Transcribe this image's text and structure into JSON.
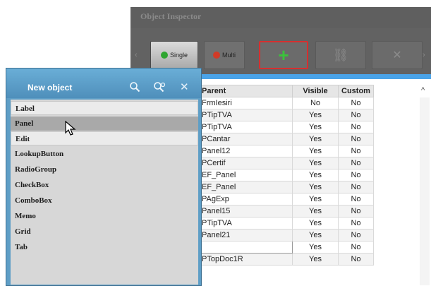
{
  "window": {
    "title": "Object Inspector"
  },
  "toolbar": {
    "single_label": "Single",
    "multi_label": "Multi",
    "add_symbol": "+",
    "link_symbol": "⛓",
    "delete_symbol": "✕",
    "colors": {
      "single_dot": "#2fa531",
      "multi_dot": "#d13a27",
      "add": "#3cc23c",
      "highlight_border": "#d62f2f"
    }
  },
  "new_object": {
    "title": "New object",
    "items": [
      {
        "label": "Label",
        "state": "light"
      },
      {
        "label": "Panel",
        "state": "selected"
      },
      {
        "label": "Edit",
        "state": "light"
      },
      {
        "label": "LookupButton",
        "state": "plain"
      },
      {
        "label": "RadioGroup",
        "state": "plain"
      },
      {
        "label": "CheckBox",
        "state": "plain"
      },
      {
        "label": "ComboBox",
        "state": "plain"
      },
      {
        "label": "Memo",
        "state": "plain"
      },
      {
        "label": "Grid",
        "state": "plain"
      },
      {
        "label": "Tab",
        "state": "plain"
      }
    ]
  },
  "grid": {
    "columns": [
      "Parent",
      "Visible",
      "Custom"
    ],
    "rows": [
      [
        "FrmIesiri",
        "No",
        "No"
      ],
      [
        "PTipTVA",
        "Yes",
        "No"
      ],
      [
        "PTipTVA",
        "Yes",
        "No"
      ],
      [
        "PCantar",
        "Yes",
        "No"
      ],
      [
        "Panel12",
        "Yes",
        "No"
      ],
      [
        "PCertif",
        "Yes",
        "No"
      ],
      [
        "EF_Panel",
        "Yes",
        "No"
      ],
      [
        "EF_Panel",
        "Yes",
        "No"
      ],
      [
        "PAgExp",
        "Yes",
        "No"
      ],
      [
        "Panel15",
        "Yes",
        "No"
      ],
      [
        "PTipTVA",
        "Yes",
        "No"
      ],
      [
        "Panel21",
        "Yes",
        "No"
      ],
      [
        "",
        "Yes",
        "No"
      ],
      [
        "PTopDoc1R",
        "Yes",
        "No"
      ]
    ]
  }
}
